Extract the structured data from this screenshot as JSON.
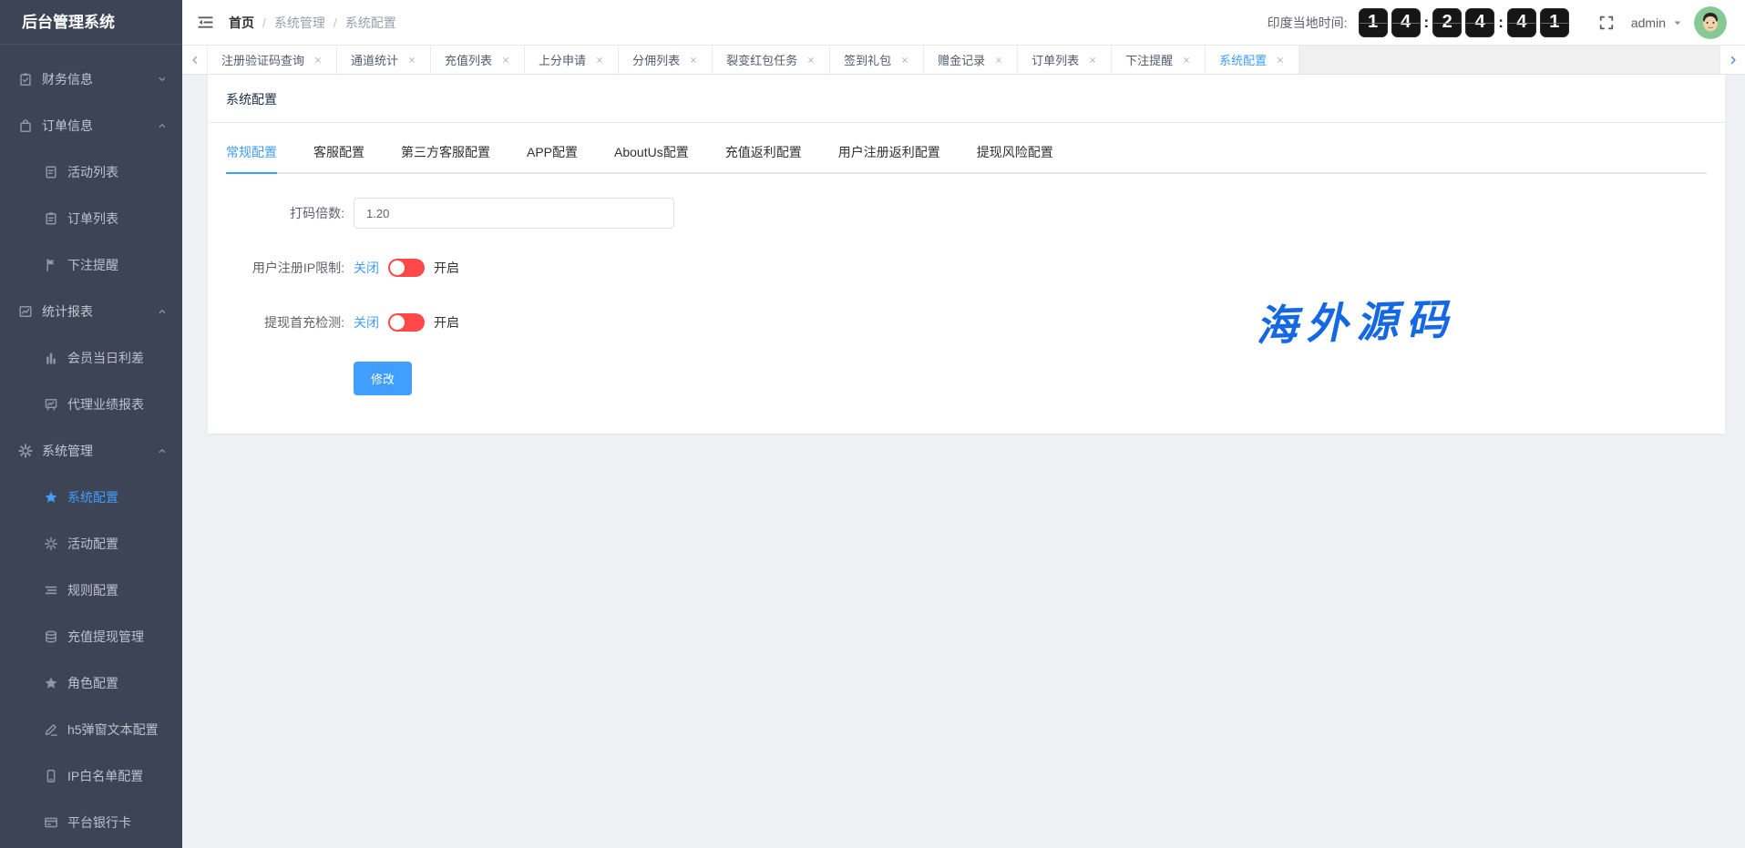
{
  "colors": {
    "accent": "#409eff",
    "switch_off_red": "#ff4949",
    "sidebar_bg": "#3c4456",
    "watermark_blue": "#1568e4",
    "clock_tile_bg": "#161616",
    "avatar_bg": "#87c995"
  },
  "app": {
    "title": "后台管理系统"
  },
  "topbar": {
    "breadcrumb": {
      "items": [
        "首页",
        "系统管理",
        "系统配置"
      ],
      "separator": "/"
    },
    "clock": {
      "label": "印度当地时间:",
      "separator": ":",
      "groups": [
        [
          "1",
          "4"
        ],
        [
          "2",
          "4"
        ],
        [
          "4",
          "1"
        ]
      ]
    },
    "user": {
      "name": "admin"
    }
  },
  "sidebar": {
    "items": [
      {
        "id": "finance-info",
        "label": "财务信息",
        "icon": "clipboard-check-icon",
        "type": "group",
        "state": "collapsed"
      },
      {
        "id": "order-info",
        "label": "订单信息",
        "icon": "bag-icon",
        "type": "group",
        "state": "expanded"
      },
      {
        "id": "activity-list",
        "label": "活动列表",
        "icon": "document-icon",
        "type": "sub"
      },
      {
        "id": "order-list",
        "label": "订单列表",
        "icon": "clipboard-icon",
        "type": "sub"
      },
      {
        "id": "bet-reminder",
        "label": "下注提醒",
        "icon": "flag-icon",
        "type": "sub"
      },
      {
        "id": "stats-report",
        "label": "统计报表",
        "icon": "trend-chart-icon",
        "type": "group",
        "state": "expanded"
      },
      {
        "id": "member-daily-profit",
        "label": "会员当日利差",
        "icon": "bar-chart-icon",
        "type": "sub"
      },
      {
        "id": "agent-performance-report",
        "label": "代理业绩报表",
        "icon": "board-chart-icon",
        "type": "sub"
      },
      {
        "id": "system-management",
        "label": "系统管理",
        "icon": "gear-icon",
        "type": "group",
        "state": "expanded"
      },
      {
        "id": "system-config",
        "label": "系统配置",
        "icon": "star-icon",
        "type": "sub",
        "active": true
      },
      {
        "id": "activity-config",
        "label": "活动配置",
        "icon": "sparkle-icon",
        "type": "sub"
      },
      {
        "id": "rule-config",
        "label": "规则配置",
        "icon": "list-icon",
        "type": "sub"
      },
      {
        "id": "recharge-withdraw-management",
        "label": "充值提现管理",
        "icon": "database-icon",
        "type": "sub"
      },
      {
        "id": "role-config",
        "label": "角色配置",
        "icon": "star-icon",
        "type": "sub"
      },
      {
        "id": "h5-popup-text-config",
        "label": "h5弹窗文本配置",
        "icon": "pen-icon",
        "type": "sub"
      },
      {
        "id": "ip-whitelist-config",
        "label": "IP白名单配置",
        "icon": "mobile-icon",
        "type": "sub"
      },
      {
        "id": "platform-bank-card",
        "label": "平台银行卡",
        "icon": "bank-card-icon",
        "type": "sub"
      }
    ]
  },
  "tabbar": {
    "tabs": [
      {
        "id": "register-captcha-query",
        "label": "注册验证码查询",
        "closable": true
      },
      {
        "id": "channel-stats",
        "label": "通道统计",
        "closable": true
      },
      {
        "id": "recharge-list",
        "label": "充值列表",
        "closable": true
      },
      {
        "id": "score-apply",
        "label": "上分申请",
        "closable": true
      },
      {
        "id": "commission-list",
        "label": "分佣列表",
        "closable": true
      },
      {
        "id": "fission-redpacket-task",
        "label": "裂变红包任务",
        "closable": true
      },
      {
        "id": "signin-gift",
        "label": "签到礼包",
        "closable": true
      },
      {
        "id": "bonus-record",
        "label": "赠金记录",
        "closable": true
      },
      {
        "id": "order-list",
        "label": "订单列表",
        "closable": true
      },
      {
        "id": "bet-reminder",
        "label": "下注提醒",
        "closable": true
      },
      {
        "id": "system-config",
        "label": "系统配置",
        "closable": true,
        "active": true
      }
    ]
  },
  "page": {
    "title": "系统配置",
    "config_tabs": [
      {
        "id": "general",
        "label": "常规配置",
        "active": true
      },
      {
        "id": "customer-service",
        "label": "客服配置"
      },
      {
        "id": "third-party-cs",
        "label": "第三方客服配置"
      },
      {
        "id": "app",
        "label": "APP配置"
      },
      {
        "id": "aboutus",
        "label": "AboutUs配置"
      },
      {
        "id": "recharge-rebate",
        "label": "充值返利配置"
      },
      {
        "id": "register-rebate",
        "label": "用户注册返利配置"
      },
      {
        "id": "withdraw-risk",
        "label": "提现风险配置"
      }
    ],
    "form": {
      "fields": [
        {
          "id": "dama-multiplier",
          "type": "input",
          "label": "打码倍数:",
          "value": "1.20"
        },
        {
          "id": "register-ip-limit",
          "type": "switch",
          "label": "用户注册IP限制:",
          "off_label": "关闭",
          "on_label": "开启",
          "state": "off"
        },
        {
          "id": "withdraw-first-charge-check",
          "type": "switch",
          "label": "提现首充检测:",
          "off_label": "关闭",
          "on_label": "开启",
          "state": "off"
        }
      ],
      "submit_label": "修改"
    },
    "watermark": "海外源码"
  }
}
